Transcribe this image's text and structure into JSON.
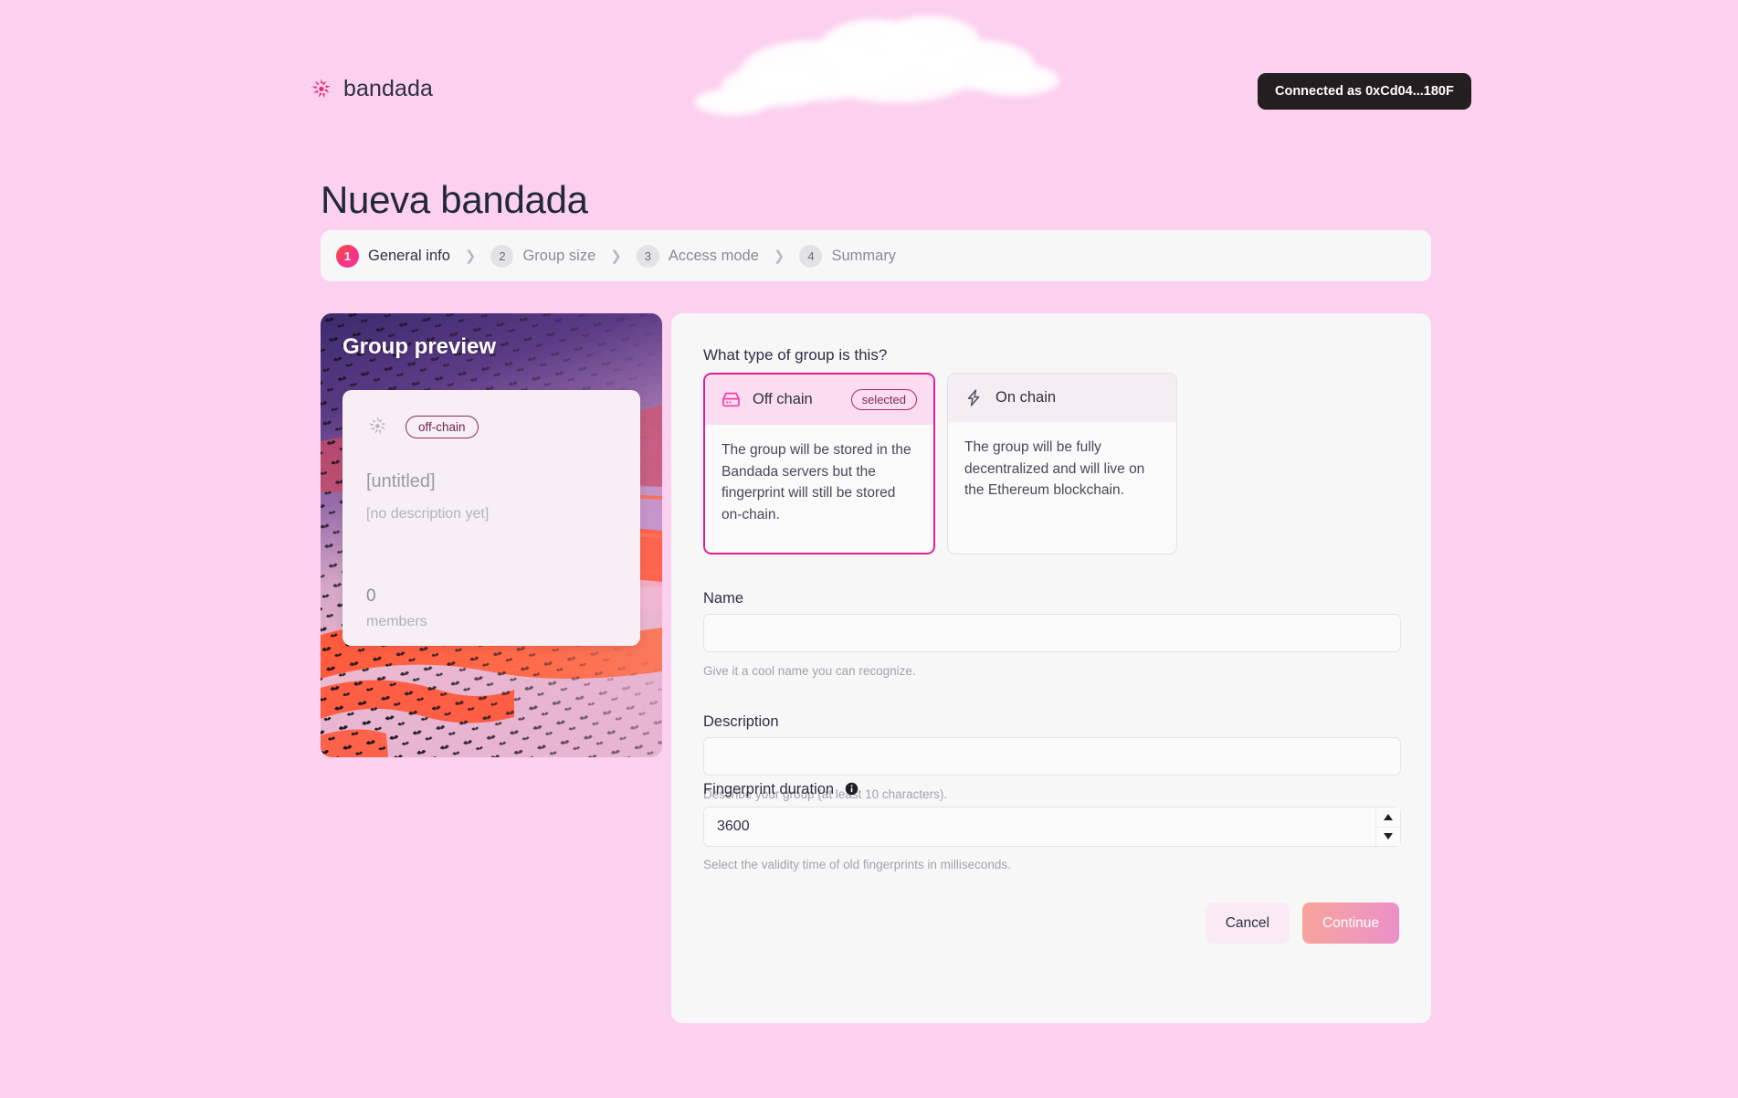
{
  "brand": {
    "name": "bandada",
    "logo_icon": "bandada-bird-logo"
  },
  "wallet": {
    "status_label": "Connected as 0xCd04...180F"
  },
  "page": {
    "title": "Nueva bandada"
  },
  "stepper": {
    "steps": [
      {
        "number": "1",
        "label": "General info",
        "active": true
      },
      {
        "number": "2",
        "label": "Group size",
        "active": false
      },
      {
        "number": "3",
        "label": "Access mode",
        "active": false
      },
      {
        "number": "4",
        "label": "Summary",
        "active": false
      }
    ],
    "separator": "❯"
  },
  "preview": {
    "title": "Group preview",
    "bird_icon": "bird-flock-icon",
    "chain_pill": "off-chain",
    "name_placeholder": "[untitled]",
    "description_placeholder": "[no description yet]",
    "member_count": "0",
    "member_label": "members"
  },
  "form": {
    "question": "What type of group is this?",
    "types": [
      {
        "icon": "hard-drive-icon",
        "title": "Off chain",
        "badge": "selected",
        "description": "The group will be stored in the Bandada servers but the fingerprint will still be stored on-chain.",
        "selected": true
      },
      {
        "icon": "lightning-bolt-icon",
        "title": "On chain",
        "badge": "",
        "description": "The group will be fully decentralized and will live on the Ethereum blockchain.",
        "selected": false
      }
    ],
    "name_field": {
      "label": "Name",
      "value": "",
      "placeholder": "",
      "hint": "Give it a cool name you can recognize."
    },
    "description_field": {
      "label": "Description",
      "value": "",
      "placeholder": "",
      "hint": "Describe your group (at least 10 characters)."
    },
    "duration_field": {
      "label": "Fingerprint duration",
      "info_icon": "info-icon",
      "value": "3600",
      "hint": "Select the validity time of old fingerprints in milliseconds."
    },
    "buttons": {
      "cancel": "Cancel",
      "continue": "Continue"
    }
  },
  "colors": {
    "page_background": "#fcd0ef",
    "accent_pink": "#e01f8f",
    "panel_background": "#f7f7f8",
    "badge_dark": "#231f20",
    "text_dark": "#2d3142"
  }
}
